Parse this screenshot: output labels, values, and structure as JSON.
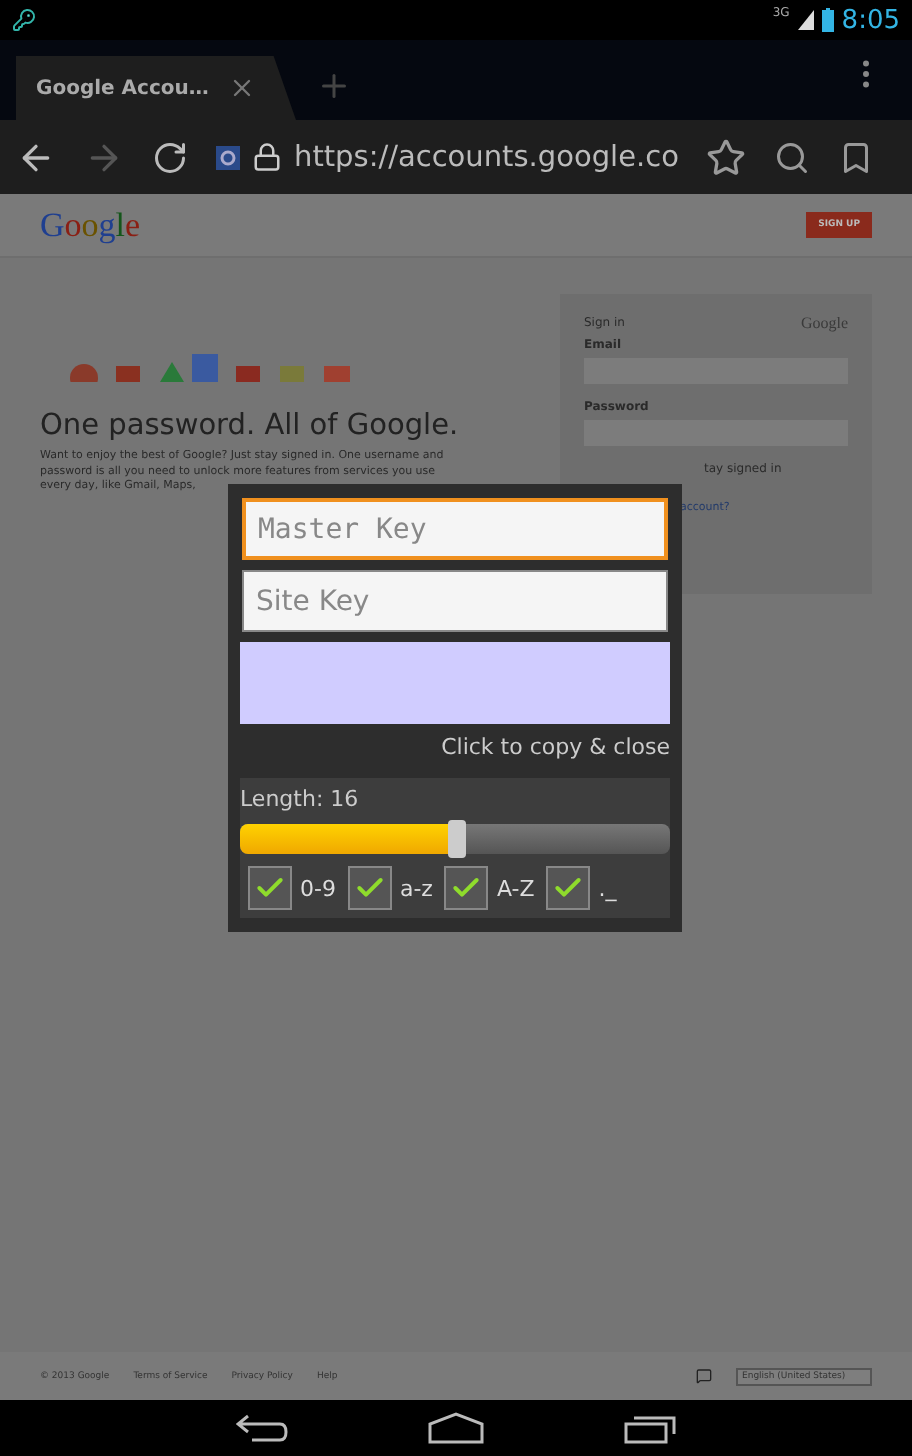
{
  "status_bar": {
    "time": "8:05",
    "network": "3G"
  },
  "browser": {
    "tab": {
      "title": "Google Accou…",
      "selected": true
    },
    "url": "https://accounts.google.co"
  },
  "page": {
    "logo": "Google",
    "signup": "SIGN UP",
    "headline": "One password. All of Google.",
    "intro": "Want to enjoy the best of Google? Just stay signed in. One username and password is all you need to unlock more features from services you use every day, like Gmail, Maps,",
    "signin": {
      "title": "Sign in",
      "brand": "Google",
      "email_label": "Email",
      "password_label": "Password",
      "stay": "tay signed in",
      "link": "account?"
    },
    "footer": {
      "links": [
        "© 2013 Google",
        "Terms of Service",
        "Privacy Policy",
        "Help"
      ],
      "language": "English (United States)"
    }
  },
  "dialog": {
    "master_placeholder": "Master Key",
    "site_placeholder": "Site Key",
    "copy_hint": "Click to copy & close",
    "length_label": "Length: 16",
    "length": {
      "level": 0.5
    },
    "options": [
      {
        "label": "0-9",
        "checked": true
      },
      {
        "label": "a-z",
        "checked": true
      },
      {
        "label": "A-Z",
        "checked": true
      },
      {
        "label": "._",
        "checked": true
      }
    ]
  }
}
